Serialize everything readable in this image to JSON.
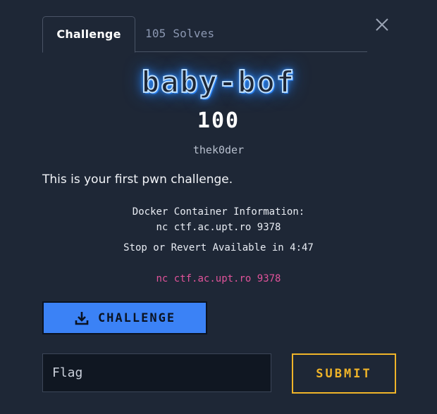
{
  "modal": {
    "close_icon": "close-icon"
  },
  "tabs": [
    {
      "label": "Challenge",
      "active": true
    },
    {
      "label": "105 Solves",
      "active": false
    }
  ],
  "challenge": {
    "name": "baby-bof",
    "points": "100",
    "author": "thek0der",
    "description": "This is your first pwn challenge.",
    "docker_info_title": "Docker Container Information:",
    "docker_info_connection": "nc ctf.ac.upt.ro 9378",
    "docker_status": "Stop or Revert Available in 4:47",
    "connection_link": "nc ctf.ac.upt.ro 9378"
  },
  "download": {
    "label": "CHALLENGE",
    "icon": "download-icon"
  },
  "flag_form": {
    "placeholder": "Flag",
    "value": "",
    "submit_label": "SUBMIT"
  },
  "colors": {
    "background": "#1e2736",
    "accent_blue": "#3b82f6",
    "link_pink": "#e0539a",
    "submit_gold": "#f0b429"
  }
}
